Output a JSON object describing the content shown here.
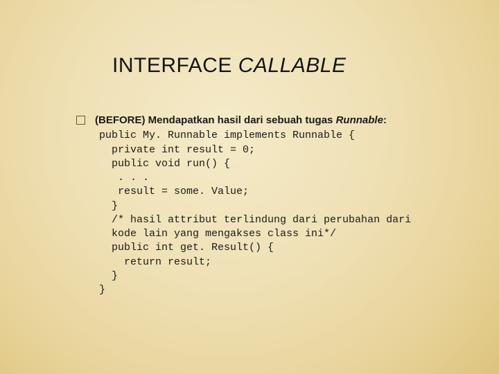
{
  "title": {
    "word1": "INTERFACE",
    "word2": "CALLABLE"
  },
  "bullet": {
    "intro_prefix": "(BEFORE) Mendapatkan hasil dari sebuah tugas ",
    "intro_em": "Runnable",
    "intro_suffix": ":"
  },
  "code_lines": [
    "public My. Runnable implements Runnable {",
    "  private int result = 0;",
    "  public void run() {",
    "   . . .",
    "   result = some. Value;",
    "  }",
    "  /* hasil attribut terlindung dari perubahan dari",
    "  kode lain yang mengakses class ini*/",
    "  public int get. Result() {",
    "    return result;",
    "  }",
    "}"
  ]
}
